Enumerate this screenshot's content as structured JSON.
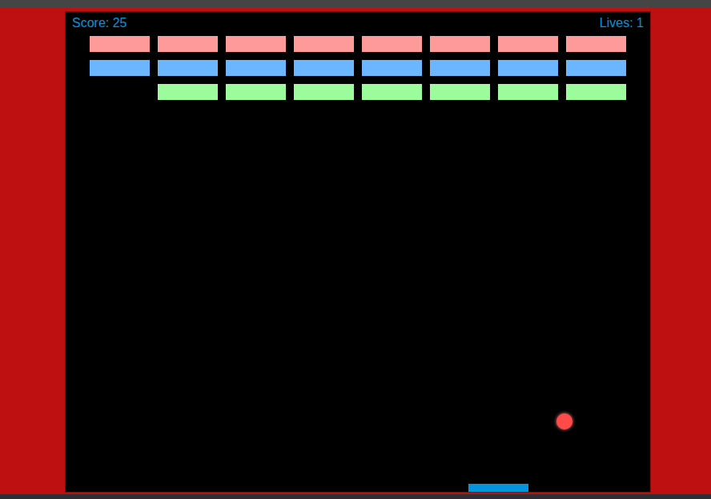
{
  "hud": {
    "score": "Score: 25",
    "lives": "Lives: 1"
  },
  "bricks": [
    {
      "color": "#ff9a9a",
      "cells": [
        {
          "broken": false
        },
        {
          "broken": false
        },
        {
          "broken": false
        },
        {
          "broken": false
        },
        {
          "broken": false
        },
        {
          "broken": false
        },
        {
          "broken": false
        },
        {
          "broken": false
        }
      ]
    },
    {
      "color": "#6cb6ff",
      "cells": [
        {
          "broken": false
        },
        {
          "broken": false
        },
        {
          "broken": false
        },
        {
          "broken": false
        },
        {
          "broken": false
        },
        {
          "broken": false
        },
        {
          "broken": false
        },
        {
          "broken": false
        }
      ]
    },
    {
      "color": "#9cfc9c",
      "cells": [
        {
          "broken": true
        },
        {
          "broken": false
        },
        {
          "broken": false
        },
        {
          "broken": false
        },
        {
          "broken": false
        },
        {
          "broken": false
        },
        {
          "broken": false
        },
        {
          "broken": false
        }
      ]
    }
  ]
}
